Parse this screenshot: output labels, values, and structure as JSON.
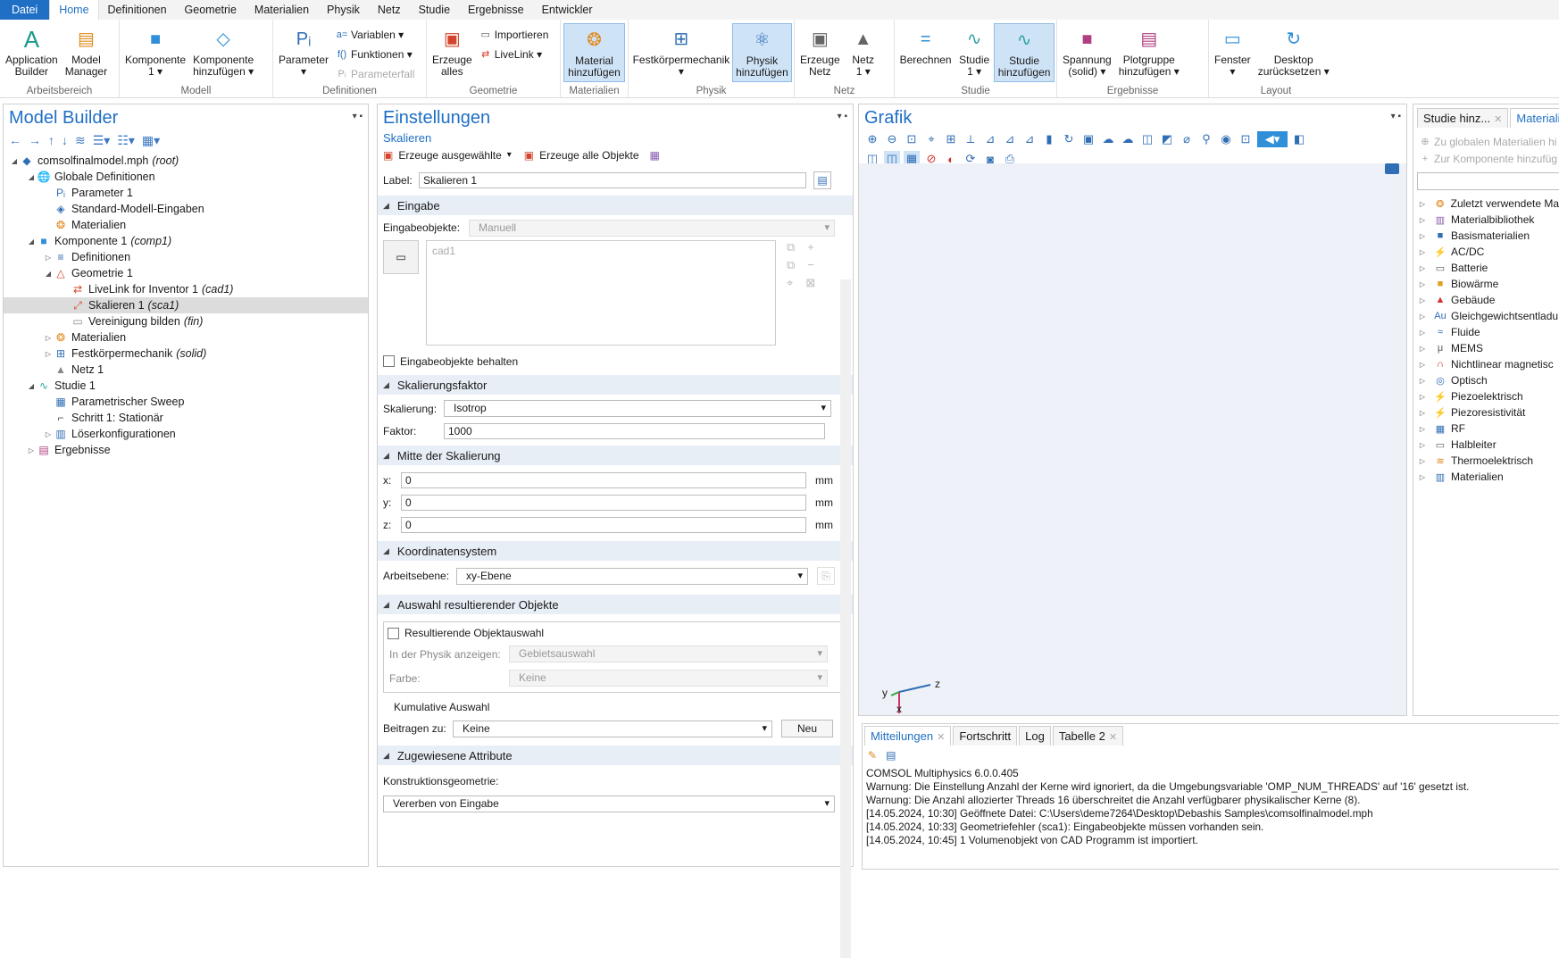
{
  "menu": [
    "Datei",
    "Home",
    "Definitionen",
    "Geometrie",
    "Materialien",
    "Physik",
    "Netz",
    "Studie",
    "Ergebnisse",
    "Entwickler"
  ],
  "ribbon": {
    "app_builder": "Application\nBuilder",
    "model_manager": "Model\nManager",
    "grp_arbeitsbereich": "Arbeitsbereich",
    "komponente": "Komponente\n1 ▾",
    "komp_hinzu": "Komponente\nhinzufügen ▾",
    "grp_modell": "Modell",
    "parameter": "Parameter\n▾",
    "variablen": "Variablen ▾",
    "funktionen": "Funktionen ▾",
    "parameterfall": "Parameterfall",
    "grp_definitionen": "Definitionen",
    "erzeuge_alles": "Erzeuge\nalles",
    "importieren": "Importieren",
    "livelink": "LiveLink ▾",
    "grp_geometrie": "Geometrie",
    "material_hinzu": "Material\nhinzufügen",
    "grp_materialien": "Materialien",
    "festkoerper": "Festkörpermechanik\n▾",
    "physik_hinzu": "Physik\nhinzufügen",
    "grp_physik": "Physik",
    "erzeuge_netz": "Erzeuge\nNetz",
    "netz1": "Netz\n1 ▾",
    "grp_netz": "Netz",
    "berechnen": "Berechnen",
    "studie1": "Studie\n1 ▾",
    "studie_hinzu": "Studie\nhinzufügen",
    "grp_studie": "Studie",
    "spannung": "Spannung\n(solid) ▾",
    "plotgruppe": "Plotgruppe\nhinzufügen ▾",
    "grp_ergebnisse": "Ergebnisse",
    "fenster": "Fenster\n▾",
    "desktop": "Desktop\nzurücksetzen ▾",
    "grp_layout": "Layout"
  },
  "model_builder": {
    "title": "Model Builder",
    "tree": [
      {
        "label": "comsolfinalmodel.mph",
        "tag": "(root)",
        "level": 0,
        "toggle": "◢",
        "icon": "◆",
        "color": "#2f6db5"
      },
      {
        "label": "Globale Definitionen",
        "tag": "",
        "level": 1,
        "toggle": "◢",
        "icon": "🌐",
        "color": "#2f6db5"
      },
      {
        "label": "Parameter 1",
        "tag": "",
        "level": 2,
        "toggle": "",
        "icon": "Pᵢ",
        "color": "#2f6db5"
      },
      {
        "label": "Standard-Modell-Eingaben",
        "tag": "",
        "level": 2,
        "toggle": "",
        "icon": "◈",
        "color": "#2f6db5"
      },
      {
        "label": "Materialien",
        "tag": "",
        "level": 2,
        "toggle": "",
        "icon": "❂",
        "color": "#e08a1e"
      },
      {
        "label": "Komponente 1",
        "tag": "(comp1)",
        "level": 1,
        "toggle": "◢",
        "icon": "■",
        "color": "#2f8fd8"
      },
      {
        "label": "Definitionen",
        "tag": "",
        "level": 2,
        "toggle": "▷",
        "icon": "≡",
        "color": "#2f6db5"
      },
      {
        "label": "Geometrie 1",
        "tag": "",
        "level": 2,
        "toggle": "◢",
        "icon": "△",
        "color": "#d2452c"
      },
      {
        "label": "LiveLink for Inventor 1",
        "tag": "(cad1)",
        "level": 3,
        "toggle": "",
        "icon": "⇄",
        "color": "#d2452c"
      },
      {
        "label": "Skalieren 1",
        "tag": "(sca1)",
        "level": 3,
        "toggle": "",
        "icon": "⤢",
        "color": "#d2452c",
        "selected": true
      },
      {
        "label": "Vereinigung bilden",
        "tag": "(fin)",
        "level": 3,
        "toggle": "",
        "icon": "▭",
        "color": "#888"
      },
      {
        "label": "Materialien",
        "tag": "",
        "level": 2,
        "toggle": "▷",
        "icon": "❂",
        "color": "#e08a1e"
      },
      {
        "label": "Festkörpermechanik",
        "tag": "(solid)",
        "level": 2,
        "toggle": "▷",
        "icon": "⊞",
        "color": "#2f6db5"
      },
      {
        "label": "Netz 1",
        "tag": "",
        "level": 2,
        "toggle": "",
        "icon": "▲",
        "color": "#888"
      },
      {
        "label": "Studie 1",
        "tag": "",
        "level": 1,
        "toggle": "◢",
        "icon": "∿",
        "color": "#2fa3a3"
      },
      {
        "label": "Parametrischer Sweep",
        "tag": "",
        "level": 2,
        "toggle": "",
        "icon": "▦",
        "color": "#2f6db5"
      },
      {
        "label": "Schritt 1: Stationär",
        "tag": "",
        "level": 2,
        "toggle": "",
        "icon": "⌐",
        "color": "#555"
      },
      {
        "label": "Löserkonfigurationen",
        "tag": "",
        "level": 2,
        "toggle": "▷",
        "icon": "▥",
        "color": "#2f6db5"
      },
      {
        "label": "Ergebnisse",
        "tag": "",
        "level": 1,
        "toggle": "▷",
        "icon": "▤",
        "color": "#b04080"
      }
    ]
  },
  "settings": {
    "title": "Einstellungen",
    "subtitle": "Skalieren",
    "build_selected": "Erzeuge ausgewählte",
    "build_all": "Erzeuge alle Objekte",
    "label_lbl": "Label:",
    "label_val": "Skalieren 1",
    "sec_eingabe": "Eingabe",
    "eingabeobjekte_lbl": "Eingabeobjekte:",
    "eingabeobjekte_val": "Manuell",
    "list_item": "cad1",
    "behalten": "Eingabeobjekte behalten",
    "sec_faktor": "Skalierungsfaktor",
    "skalierung_lbl": "Skalierung:",
    "skalierung_val": "Isotrop",
    "faktor_lbl": "Faktor:",
    "faktor_val": "1000",
    "sec_mitte": "Mitte der Skalierung",
    "x_lbl": "x:",
    "x_val": "0",
    "y_lbl": "y:",
    "y_val": "0",
    "z_lbl": "z:",
    "z_val": "0",
    "unit": "mm",
    "sec_koord": "Koordinatensystem",
    "arbeitsebene_lbl": "Arbeitsebene:",
    "arbeitsebene_val": "xy-Ebene",
    "sec_auswahl": "Auswahl resultierender Objekte",
    "res_auswahl": "Resultierende Objektauswahl",
    "physik_anzeigen_lbl": "In der Physik anzeigen:",
    "physik_anzeigen_val": "Gebietsauswahl",
    "farbe_lbl": "Farbe:",
    "farbe_val": "Keine",
    "kumulativ": "Kumulative Auswahl",
    "beitragen_lbl": "Beitragen zu:",
    "beitragen_val": "Keine",
    "neu": "Neu",
    "sec_attribute": "Zugewiesene Attribute",
    "konstruktion_lbl": "Konstruktionsgeometrie:",
    "konstruktion_val": "Vererben von Eingabe"
  },
  "graphics": {
    "title": "Grafik",
    "axis_x": "x",
    "axis_y": "y",
    "axis_z": "z"
  },
  "right": {
    "tab1": "Studie hinz...",
    "tab2": "Materiali",
    "add_global": "Zu globalen Materialien hi",
    "add_comp": "Zur Komponente hinzufüg",
    "items": [
      {
        "label": "Zuletzt verwendete Ma",
        "icon": "❂",
        "color": "#e08a1e"
      },
      {
        "label": "Materialbibliothek",
        "icon": "▥",
        "color": "#8a5ab0"
      },
      {
        "label": "Basismaterialien",
        "icon": "■",
        "color": "#2f6db5"
      },
      {
        "label": "AC/DC",
        "icon": "⚡",
        "color": "#2f6db5"
      },
      {
        "label": "Batterie",
        "icon": "▭",
        "color": "#555"
      },
      {
        "label": "Biowärme",
        "icon": "■",
        "color": "#e0a020"
      },
      {
        "label": "Gebäude",
        "icon": "▲",
        "color": "#d23030"
      },
      {
        "label": "Gleichgewichtsentladu",
        "icon": "Au",
        "color": "#2f6db5"
      },
      {
        "label": "Fluide",
        "icon": "≈",
        "color": "#2f6db5"
      },
      {
        "label": "MEMS",
        "icon": "μ",
        "color": "#555"
      },
      {
        "label": "Nichtlinear magnetisc",
        "icon": "∩",
        "color": "#d23030"
      },
      {
        "label": "Optisch",
        "icon": "◎",
        "color": "#2f6db5"
      },
      {
        "label": "Piezoelektrisch",
        "icon": "⚡",
        "color": "#2f6db5"
      },
      {
        "label": "Piezoresistivität",
        "icon": "⚡",
        "color": "#555"
      },
      {
        "label": "RF",
        "icon": "▦",
        "color": "#2f6db5"
      },
      {
        "label": "Halbleiter",
        "icon": "▭",
        "color": "#555"
      },
      {
        "label": "Thermoelektrisch",
        "icon": "≋",
        "color": "#e08a1e"
      },
      {
        "label": "Materialien",
        "icon": "▥",
        "color": "#2f6db5"
      }
    ]
  },
  "messages": {
    "tabs": [
      "Mitteilungen",
      "Fortschritt",
      "Log",
      "Tabelle 2"
    ],
    "lines": [
      "COMSOL Multiphysics 6.0.0.405",
      "Warnung: Die Einstellung Anzahl der Kerne wird ignoriert, da die Umgebungsvariable 'OMP_NUM_THREADS' auf '16' gesetzt ist.",
      "Warnung: Die Anzahl allozierter Threads 16 überschreitet die Anzahl verfügbarer physikalischer Kerne (8).",
      "[14.05.2024, 10:30] Geöffnete Datei: C:\\Users\\deme7264\\Desktop\\Debashis Samples\\comsolfinalmodel.mph",
      "[14.05.2024, 10:33] Geometriefehler (sca1): Eingabeobjekte müssen vorhanden sein.",
      "[14.05.2024, 10:45] 1 Volumenobjekt von CAD Programm ist importiert."
    ]
  }
}
